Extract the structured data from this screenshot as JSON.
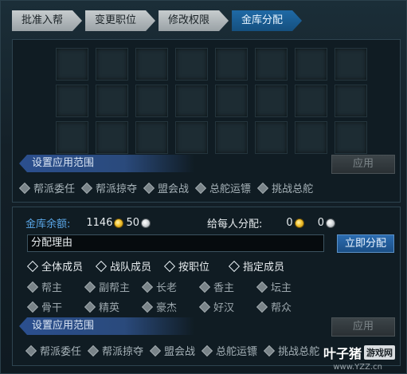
{
  "tabs": [
    {
      "label": "批准入帮"
    },
    {
      "label": "变更职位"
    },
    {
      "label": "修改权限"
    },
    {
      "label": "金库分配"
    }
  ],
  "panel_top": {
    "scope_label": "设置应用范围",
    "apply_label": "应用",
    "options": [
      "帮派委任",
      "帮派掠夺",
      "盟会战",
      "总舵运镖",
      "挑战总舵"
    ]
  },
  "treasury": {
    "balance_label": "金库余额:",
    "gold_amount": "1146",
    "silver_amount": "50",
    "per_person_label": "给每人分配:",
    "per_gold": "0",
    "per_silver": "0",
    "reason_value": "分配理由",
    "distribute_label": "立即分配",
    "member_options": [
      "全体成员",
      "战队成员",
      "按职位",
      "指定成员"
    ],
    "roles": [
      "帮主",
      "副帮主",
      "长老",
      "香主",
      "坛主",
      "骨干",
      "精英",
      "豪杰",
      "好汉",
      "帮众"
    ]
  },
  "panel_bottom": {
    "scope_label": "设置应用范围",
    "apply_label": "应用",
    "options": [
      "帮派委任",
      "帮派掠夺",
      "盟会战",
      "总舵运镖",
      "挑战总舵"
    ]
  },
  "watermark": {
    "text": "叶子猪",
    "box": "游戏网",
    "url": "www.YZZ.cn"
  },
  "colors": {
    "active_tab": "#1f6aa6",
    "label_blue": "#5aa7e8",
    "ribbon": "#2b4f8e",
    "gold_coin": "#f2c230"
  }
}
